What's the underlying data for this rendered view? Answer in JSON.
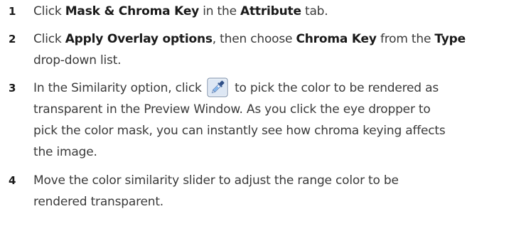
{
  "steps": [
    {
      "number": "1",
      "t1": "Click ",
      "b1": "Mask & Chroma Key",
      "t2": " in the ",
      "b2": "Attribute",
      "t3": " tab."
    },
    {
      "number": "2",
      "t1": "Click ",
      "b1": "Apply Overlay options",
      "t2": ", then choose ",
      "b2": "Chroma Key",
      "t3": " from the ",
      "b3": "Type",
      "t4": "drop-down list."
    },
    {
      "number": "3",
      "t1": "In the Similarity option, click",
      "icon": "eyedropper-icon",
      "t2": "to pick the color to be rendered as",
      "l2": "transparent in the Preview Window. As you click the eye dropper to",
      "l3": "pick the color mask, you can instantly see how chroma keying affects",
      "l4": "the image."
    },
    {
      "number": "4",
      "l1": "Move the color similarity slider to adjust the range color to be",
      "l2": "rendered transparent."
    }
  ],
  "colors": {
    "text": "#3a3a3a",
    "bold": "#1a1a1a",
    "icon_frame": "#7a8ea8",
    "icon_fill": "#d6e2f2"
  }
}
